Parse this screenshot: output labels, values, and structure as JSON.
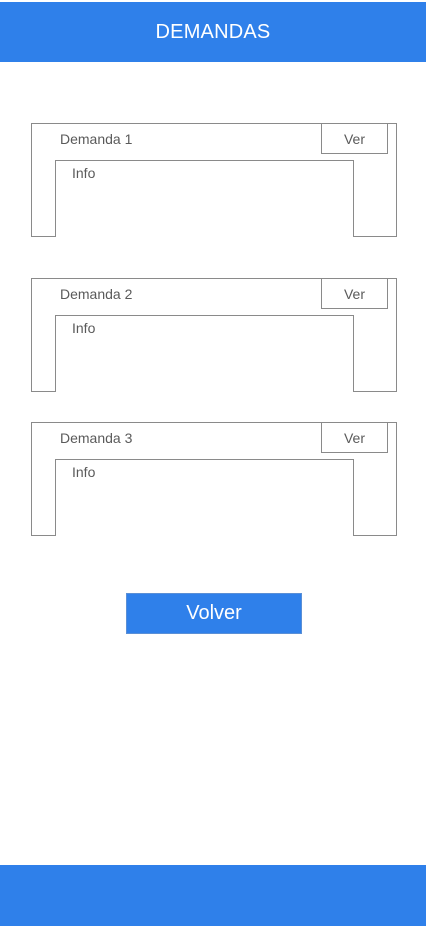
{
  "header": {
    "title": "DEMANDAS"
  },
  "demandas": [
    {
      "title": "Demanda 1",
      "action_label": "Ver",
      "info_label": "Info"
    },
    {
      "title": "Demanda 2",
      "action_label": "Ver",
      "info_label": "Info"
    },
    {
      "title": "Demanda 3",
      "action_label": "Ver",
      "info_label": "Info"
    }
  ],
  "actions": {
    "volver_label": "Volver"
  },
  "colors": {
    "primary": "#2f80ea",
    "border": "#8a8a8a",
    "text_muted": "#5a5a5a",
    "background": "#ffffff"
  }
}
